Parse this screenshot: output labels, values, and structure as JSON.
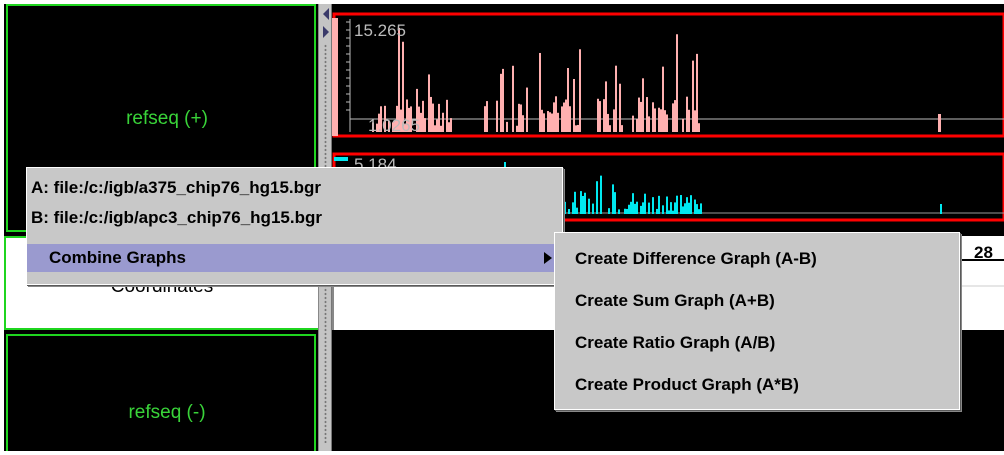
{
  "tracks": {
    "plus_label": "refseq (+)",
    "coordinates_label": "Coordinates",
    "minus_label": "refseq (-)"
  },
  "graph": {
    "a_max_label": "15.265",
    "a_min_label": "1.0265",
    "b_max_label": "5.184",
    "axis_tick_label": "28",
    "a_color": "#ffb0b0",
    "b_color": "#00e8f0",
    "frame_color": "#ff0000"
  },
  "menu": {
    "item_a": "A: file:/c:/igb/a375_chip76_hg15.bgr",
    "item_b": "B: file:/c:/igb/apc3_chip76_hg15.bgr",
    "combine": "Combine Graphs",
    "submenu": [
      "Create Difference Graph (A-B)",
      "Create Sum Graph (A+B)",
      "Create Ratio Graph (A/B)",
      "Create Product Graph (A*B)"
    ]
  }
}
